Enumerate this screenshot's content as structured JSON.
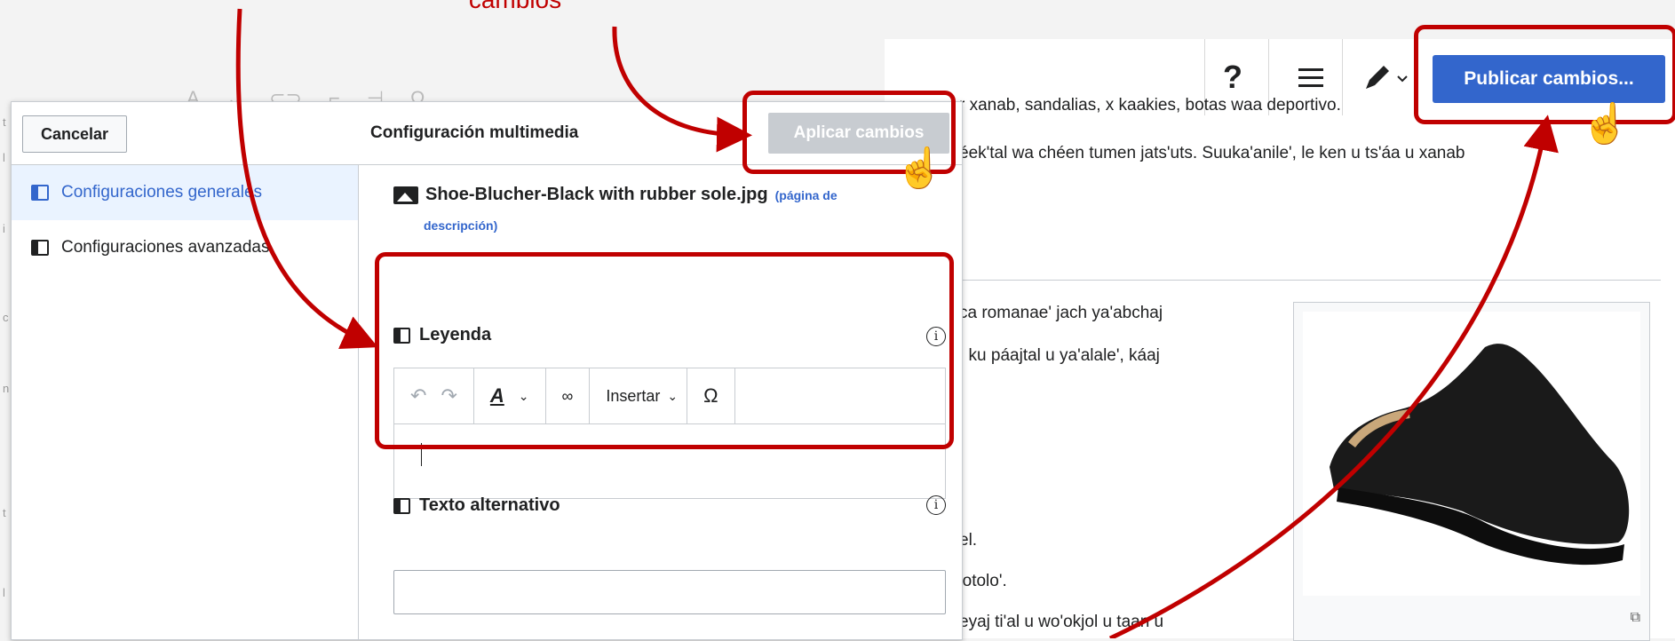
{
  "annotation": {
    "text": "cambios"
  },
  "background": {
    "left_strip": [
      "t",
      "l",
      "i",
      "c",
      "n",
      "t",
      "l"
    ],
    "article_lines": [
      "r xanab, sandalias, x kaakies, botas waa deportivo.",
      "éek'tal wa chéen tumen jats'uts. Suuka'anile', le ken u ts'áa u xanab",
      "ca romanae' jach ya'abchaj",
      ", ku páajtal u ya'alale', káaj",
      "el.",
      "'otolo'.",
      "eyaj ti'al u wo'okjol u taan u"
    ]
  },
  "topbar": {
    "help_label": "?",
    "publish_label": "Publicar cambios..."
  },
  "dialog": {
    "cancel_label": "Cancelar",
    "title": "Configuración multimedia",
    "apply_label": "Aplicar cambios",
    "sidebar": [
      {
        "label": "Configuraciones generales",
        "active": true
      },
      {
        "label": "Configuraciones avanzadas",
        "active": false
      }
    ],
    "file_name": "Shoe-Blucher-Black with rubber sole.jpg",
    "desc_link_part1": "(página de",
    "desc_link_part2": "descripción)",
    "caption_label": "Leyenda",
    "alt_label": "Texto alternativo",
    "alt_value": "",
    "toolbar": {
      "undo": "↶",
      "redo": "↷",
      "style": "A",
      "link": "🔗",
      "insert": "Insertar",
      "special": "Ω"
    }
  },
  "colors": {
    "accent": "#3366cc",
    "annotation": "#c00000",
    "disabled": "#c8ccd1"
  }
}
